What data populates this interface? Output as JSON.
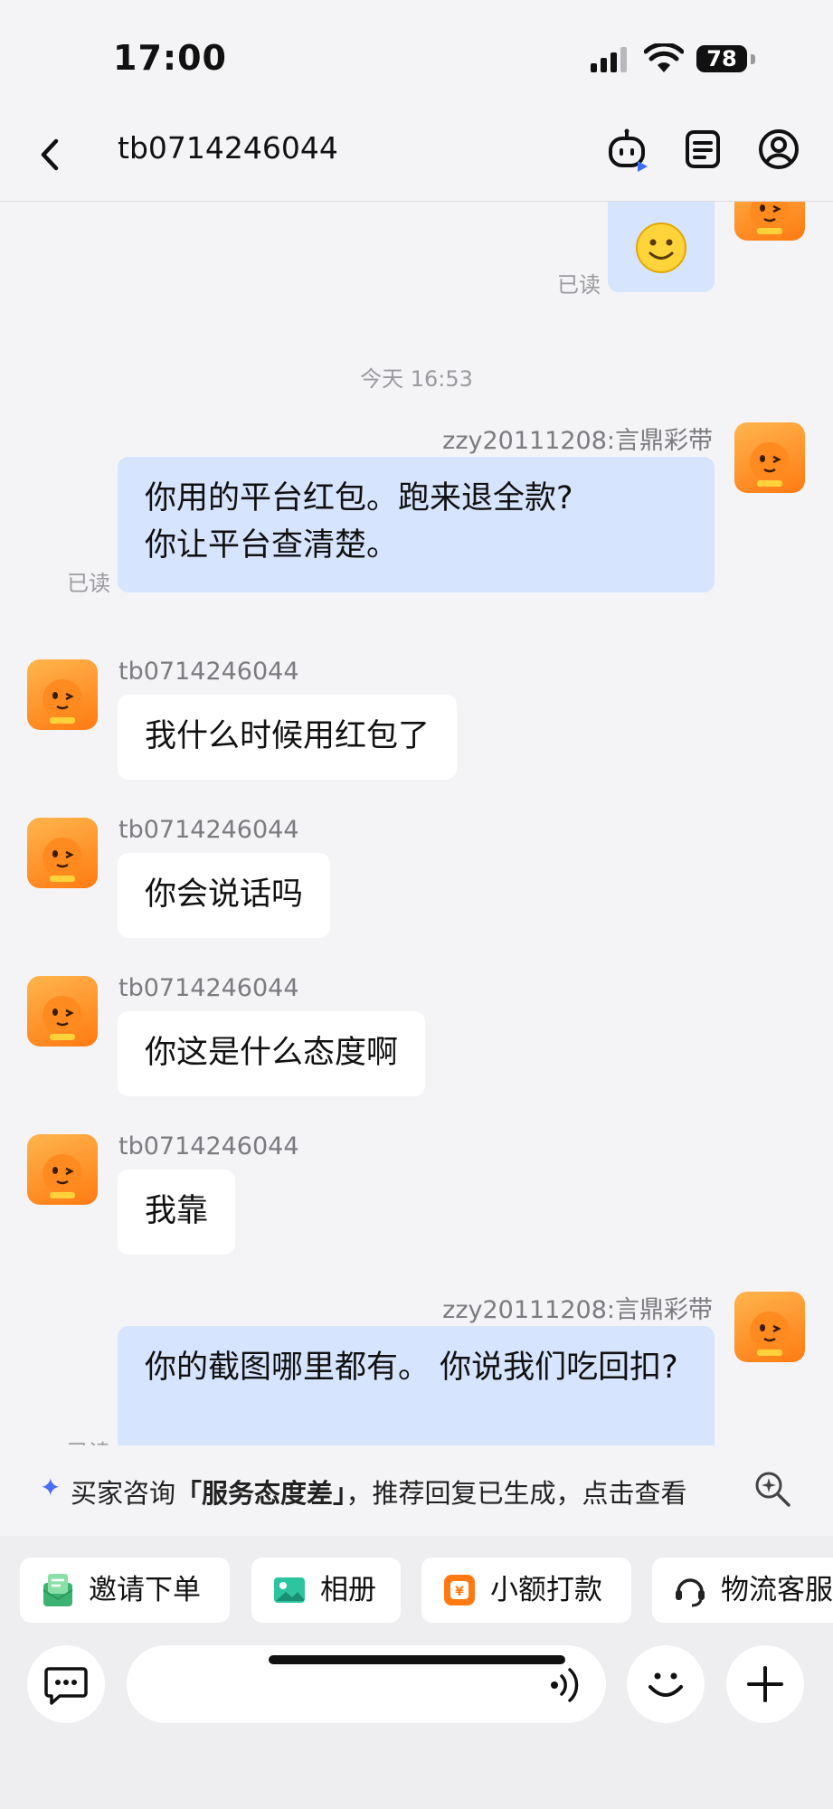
{
  "status_bar": {
    "time": "17:00",
    "battery": "78"
  },
  "header": {
    "title": "tb0714246044"
  },
  "icons": {
    "back": "chevron-left-icon",
    "robot": "robot-icon",
    "order": "order-list-icon",
    "profile": "user-icon"
  },
  "chat": {
    "top_message": {
      "content": "🙂",
      "read_status": "已读"
    },
    "time_separator": "今天 16:53",
    "messages": [
      {
        "sender": "zzy20111208:言鼎彩带",
        "text": "你用的平台红包。跑来退全款?\n你让平台查清楚。",
        "read_status": "已读"
      },
      {
        "sender": "tb0714246044",
        "text": "我什么时候用红包了"
      },
      {
        "sender": "tb0714246044",
        "text": "你会说话吗"
      },
      {
        "sender": "tb0714246044",
        "text": "你这是什么态度啊"
      },
      {
        "sender": "tb0714246044",
        "text": "我靠"
      },
      {
        "sender": "zzy20111208:言鼎彩带",
        "text": "你的截图哪里都有。 你说我们吃回扣?",
        "read_status": "已读"
      }
    ]
  },
  "ai_suggestion": {
    "prefix": "买家咨询",
    "highlight": "「服务态度差」",
    "suffix": "，推荐回复已生成，点击查看"
  },
  "quick_actions": [
    {
      "label": "邀请下单",
      "icon": "invite-order-icon",
      "color": "#3cb371"
    },
    {
      "label": "相册",
      "icon": "album-icon",
      "color": "#2cc5a0"
    },
    {
      "label": "小额打款",
      "icon": "payment-icon",
      "color": "#ff7a12"
    },
    {
      "label": "物流客服",
      "icon": "logistics-service-icon",
      "color": "#222222"
    }
  ],
  "input": {
    "placeholder": ""
  },
  "colors": {
    "outgoing_bubble": "#d6e4fe",
    "incoming_bubble": "#ffffff",
    "background": "#f4f4f6",
    "accent": "#4a6cf7"
  }
}
